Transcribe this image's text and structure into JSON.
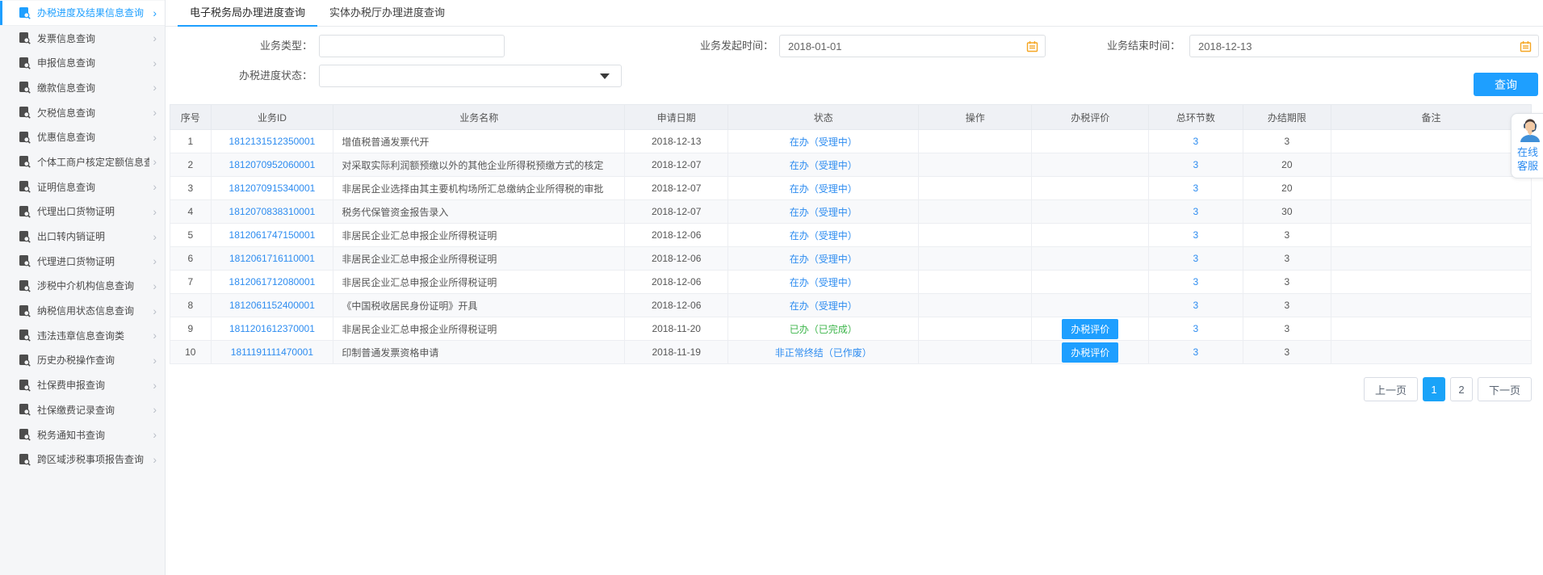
{
  "colors": {
    "accent": "#1e9fff",
    "link": "#2d8cf0",
    "success": "#3cb54a",
    "calendar_icon": "#f5a623"
  },
  "sidebar": {
    "items": [
      {
        "label": "办税进度及结果信息查询",
        "active": true
      },
      {
        "label": "发票信息查询",
        "active": false
      },
      {
        "label": "申报信息查询",
        "active": false
      },
      {
        "label": "缴款信息查询",
        "active": false
      },
      {
        "label": "欠税信息查询",
        "active": false
      },
      {
        "label": "优惠信息查询",
        "active": false
      },
      {
        "label": "个体工商户核定定额信息查询",
        "active": false
      },
      {
        "label": "证明信息查询",
        "active": false
      },
      {
        "label": "代理出口货物证明",
        "active": false
      },
      {
        "label": "出口转内销证明",
        "active": false
      },
      {
        "label": "代理进口货物证明",
        "active": false
      },
      {
        "label": "涉税中介机构信息查询",
        "active": false
      },
      {
        "label": "纳税信用状态信息查询",
        "active": false
      },
      {
        "label": "违法违章信息查询类",
        "active": false
      },
      {
        "label": "历史办税操作查询",
        "active": false
      },
      {
        "label": "社保费申报查询",
        "active": false
      },
      {
        "label": "社保缴费记录查询",
        "active": false
      },
      {
        "label": "税务通知书查询",
        "active": false
      },
      {
        "label": "跨区域涉税事项报告查询",
        "active": false
      }
    ]
  },
  "tabs": [
    {
      "label": "电子税务局办理进度查询",
      "active": true
    },
    {
      "label": "实体办税厅办理进度查询",
      "active": false
    }
  ],
  "filters": {
    "business_type": {
      "label": "业务类型：",
      "value": ""
    },
    "start_time": {
      "label": "业务发起时间：",
      "value": "2018-01-01"
    },
    "end_time": {
      "label": "业务结束时间：",
      "value": "2018-12-13"
    },
    "progress_status": {
      "label": "办税进度状态：",
      "value": ""
    },
    "search_label": "查询"
  },
  "table": {
    "headers": [
      "序号",
      "业务ID",
      "业务名称",
      "申请日期",
      "状态",
      "操作",
      "办税评价",
      "总环节数",
      "办结期限",
      "备注"
    ],
    "rows": [
      {
        "seq": "1",
        "id": "1812131512350001",
        "name": "增值税普通发票代开",
        "date": "2018-12-13",
        "status": "在办（受理中）",
        "status_type": "processing",
        "operation": "",
        "evaluation": "",
        "total_steps": "3",
        "deadline": "3",
        "remark": ""
      },
      {
        "seq": "2",
        "id": "1812070952060001",
        "name": "对采取实际利润额预缴以外的其他企业所得税预缴方式的核定",
        "date": "2018-12-07",
        "status": "在办（受理中）",
        "status_type": "processing",
        "operation": "",
        "evaluation": "",
        "total_steps": "3",
        "deadline": "20",
        "remark": ""
      },
      {
        "seq": "3",
        "id": "1812070915340001",
        "name": "非居民企业选择由其主要机构场所汇总缴纳企业所得税的审批",
        "date": "2018-12-07",
        "status": "在办（受理中）",
        "status_type": "processing",
        "operation": "",
        "evaluation": "",
        "total_steps": "3",
        "deadline": "20",
        "remark": ""
      },
      {
        "seq": "4",
        "id": "1812070838310001",
        "name": "税务代保管资金报告录入",
        "date": "2018-12-07",
        "status": "在办（受理中）",
        "status_type": "processing",
        "operation": "",
        "evaluation": "",
        "total_steps": "3",
        "deadline": "30",
        "remark": ""
      },
      {
        "seq": "5",
        "id": "1812061747150001",
        "name": "非居民企业汇总申报企业所得税证明",
        "date": "2018-12-06",
        "status": "在办（受理中）",
        "status_type": "processing",
        "operation": "",
        "evaluation": "",
        "total_steps": "3",
        "deadline": "3",
        "remark": ""
      },
      {
        "seq": "6",
        "id": "1812061716110001",
        "name": "非居民企业汇总申报企业所得税证明",
        "date": "2018-12-06",
        "status": "在办（受理中）",
        "status_type": "processing",
        "operation": "",
        "evaluation": "",
        "total_steps": "3",
        "deadline": "3",
        "remark": ""
      },
      {
        "seq": "7",
        "id": "1812061712080001",
        "name": "非居民企业汇总申报企业所得税证明",
        "date": "2018-12-06",
        "status": "在办（受理中）",
        "status_type": "processing",
        "operation": "",
        "evaluation": "",
        "total_steps": "3",
        "deadline": "3",
        "remark": ""
      },
      {
        "seq": "8",
        "id": "1812061152400001",
        "name": "《中国税收居民身份证明》开具",
        "date": "2018-12-06",
        "status": "在办（受理中）",
        "status_type": "processing",
        "operation": "",
        "evaluation": "",
        "total_steps": "3",
        "deadline": "3",
        "remark": ""
      },
      {
        "seq": "9",
        "id": "1811201612370001",
        "name": "非居民企业汇总申报企业所得税证明",
        "date": "2018-11-20",
        "status": "已办（已完成）",
        "status_type": "completed",
        "operation": "",
        "evaluation": "办税评价",
        "total_steps": "3",
        "deadline": "3",
        "remark": ""
      },
      {
        "seq": "10",
        "id": "1811191111470001",
        "name": "印制普通发票资格申请",
        "date": "2018-11-19",
        "status": "非正常终结（已作废）",
        "status_type": "terminated",
        "operation": "",
        "evaluation": "办税评价",
        "total_steps": "3",
        "deadline": "3",
        "remark": ""
      }
    ]
  },
  "pagination": {
    "prev_label": "上一页",
    "pages": [
      "1",
      "2"
    ],
    "active_page": "1",
    "next_label": "下一页"
  },
  "customer_service": {
    "label": "在线客服"
  }
}
